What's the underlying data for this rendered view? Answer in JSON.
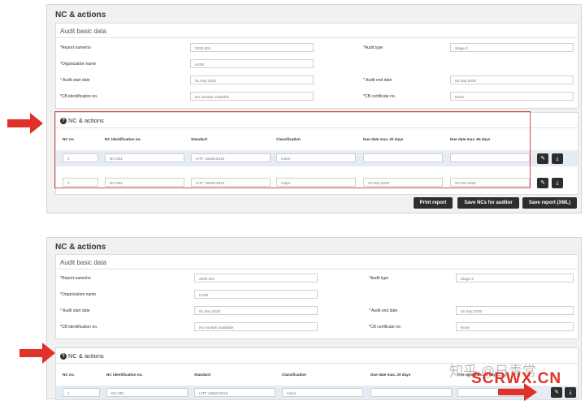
{
  "panel_title": "NC & actions",
  "section_title": "Audit basic data",
  "fields": {
    "report_name_label": "*Report name/no",
    "report_name_value": "2020-001",
    "audit_type_label": "*Audit type",
    "audit_type_value": "Stage 2",
    "org_name_label": "*Organization name",
    "org_name_value": "IAOB",
    "start_date_label": "* Audit start date",
    "start_date_value": "01.Sep.2020",
    "end_date_label": "* Audit end date",
    "end_date_value": "02.Sep.2020",
    "cb_id_label": "*CB identification no.",
    "cb_id_value": "No number available",
    "cb_cert_label": "*CB certificate no.",
    "cb_cert_value": "None"
  },
  "nc_section_title": "NC & actions",
  "columns": [
    "NC no.",
    "NC identification no.",
    "Standard",
    "Classification",
    "Due date max. 20 days",
    "Due date max. 60 days"
  ],
  "rows": [
    {
      "no": "1",
      "id": "NC-001",
      "standard": "IATF 16949:2016",
      "classification": "minor",
      "due20": "",
      "due60": ""
    },
    {
      "no": "2",
      "id": "NC-002",
      "standard": "IATF 16949:2016",
      "classification": "major",
      "due20": "22.Sep.2020",
      "due60": "01.Nov.2020"
    }
  ],
  "icons": {
    "edit": "pencil-icon",
    "download": "download-icon",
    "help": "question-circle-icon"
  },
  "buttons": {
    "print_report": "Print report",
    "save_ncs": "Save NCs for auditor",
    "save_report": "Save report (XML)"
  },
  "watermark": {
    "text1": "知乎 @日青常",
    "text2": "SCRWX.CN"
  },
  "colors": {
    "arrow": "#e0312a",
    "highlight_box": "#d64b4b",
    "button": "#2d2d2d",
    "row_highlight": "#e6ecf5"
  }
}
